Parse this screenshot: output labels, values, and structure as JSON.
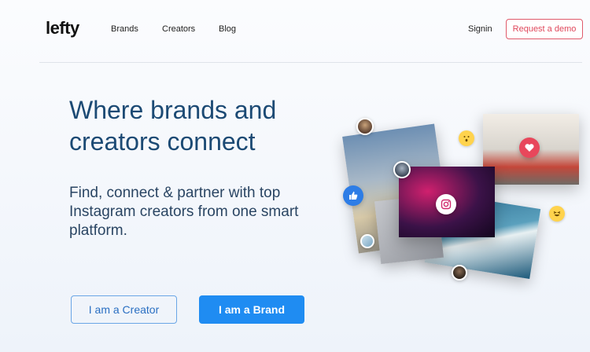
{
  "header": {
    "logo": "lefty",
    "nav": [
      {
        "label": "Brands"
      },
      {
        "label": "Creators"
      },
      {
        "label": "Blog"
      }
    ],
    "signin": "Signin",
    "demo_button": "Request a demo"
  },
  "hero": {
    "title": "Where brands and creators connect",
    "subtitle": "Find, connect & partner with top Instagram creators from one smart platform.",
    "creator_button": "I am a Creator",
    "brand_button": "I am a Brand"
  },
  "colors": {
    "title": "#1c4a74",
    "accent_blue": "#1f8cf2",
    "demo_red": "#e0485c",
    "like_blue": "#2d7de6",
    "heart_red": "#e8475b"
  },
  "icons": {
    "instagram": "instagram-icon",
    "heart": "heart-icon",
    "like": "thumbs-up-icon",
    "emoji_surprised": "surprised-emoji-icon",
    "emoji_laugh": "laughing-emoji-icon"
  }
}
